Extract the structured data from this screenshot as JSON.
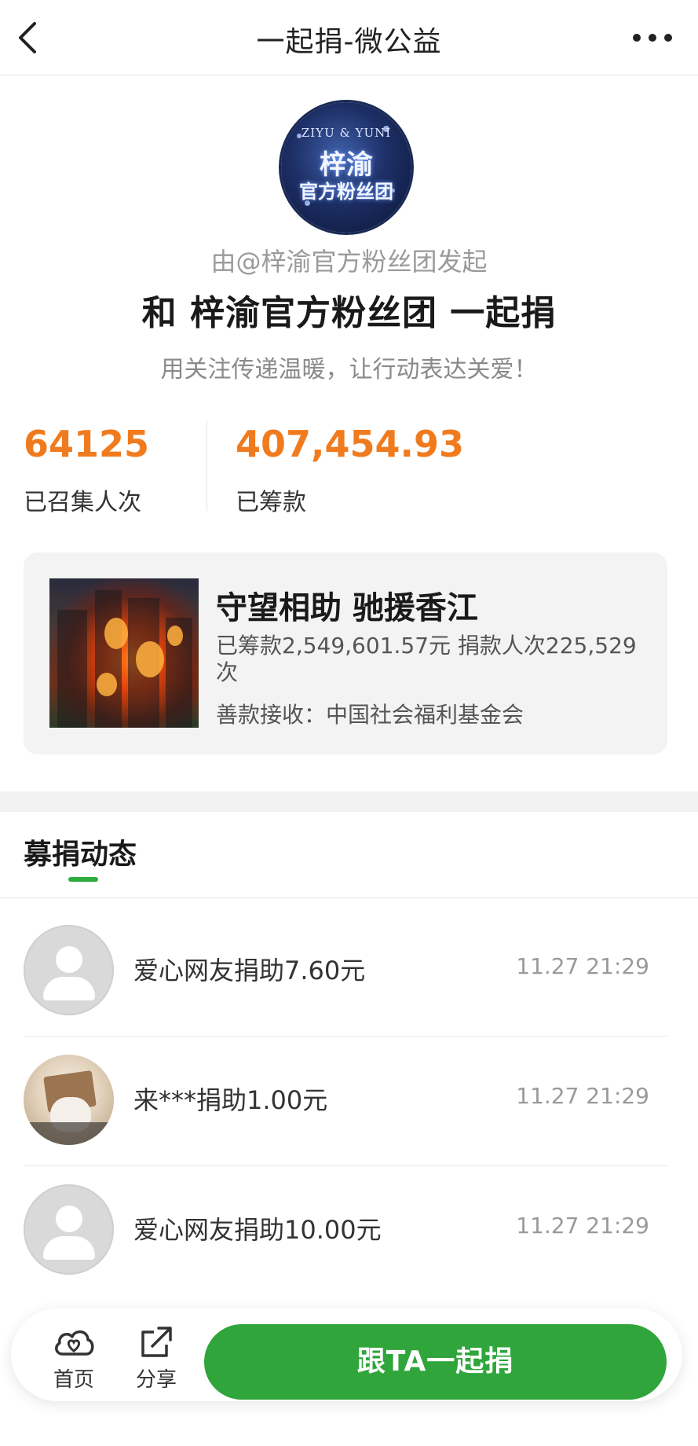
{
  "header": {
    "title": "一起捐-微公益"
  },
  "profile": {
    "avatar_text_top": "ZIYU & YUNI",
    "avatar_text_mid": "梓渝",
    "avatar_text_bot": "官方粉丝团",
    "initiator": "由@梓渝官方粉丝团发起",
    "title": "和 梓渝官方粉丝团 一起捐",
    "slogan": "用关注传递温暖，让行动表达关爱！"
  },
  "stats": {
    "participants_value": "64125",
    "participants_label": "已召集人次",
    "raised_value": "407,454.93",
    "raised_label": "已筹款"
  },
  "project": {
    "title": "守望相助 驰援香江",
    "raised_text": "已筹款2,549,601.57元  捐款人次225,529次",
    "receiver_text": "善款接收：中国社会福利基金会"
  },
  "tabs": {
    "active_label": "募捐动态"
  },
  "donations": [
    {
      "text": "爱心网友捐助7.60元",
      "time": "11.27 21:29",
      "avatar": "default"
    },
    {
      "text": "来***捐助1.00元",
      "time": "11.27 21:29",
      "avatar": "photo"
    },
    {
      "text": "爱心网友捐助10.00元",
      "time": "11.27 21:29",
      "avatar": "default"
    }
  ],
  "bottom_bar": {
    "home_label": "首页",
    "share_label": "分享",
    "donate_label": "跟TA一起捐"
  },
  "colors": {
    "accent_orange": "#f07b1e",
    "accent_green": "#2fa53b"
  },
  "icons": {
    "back": "back-arrow-icon",
    "more": "more-dots-icon",
    "home": "cloud-heart-icon",
    "share": "share-arrow-icon"
  }
}
